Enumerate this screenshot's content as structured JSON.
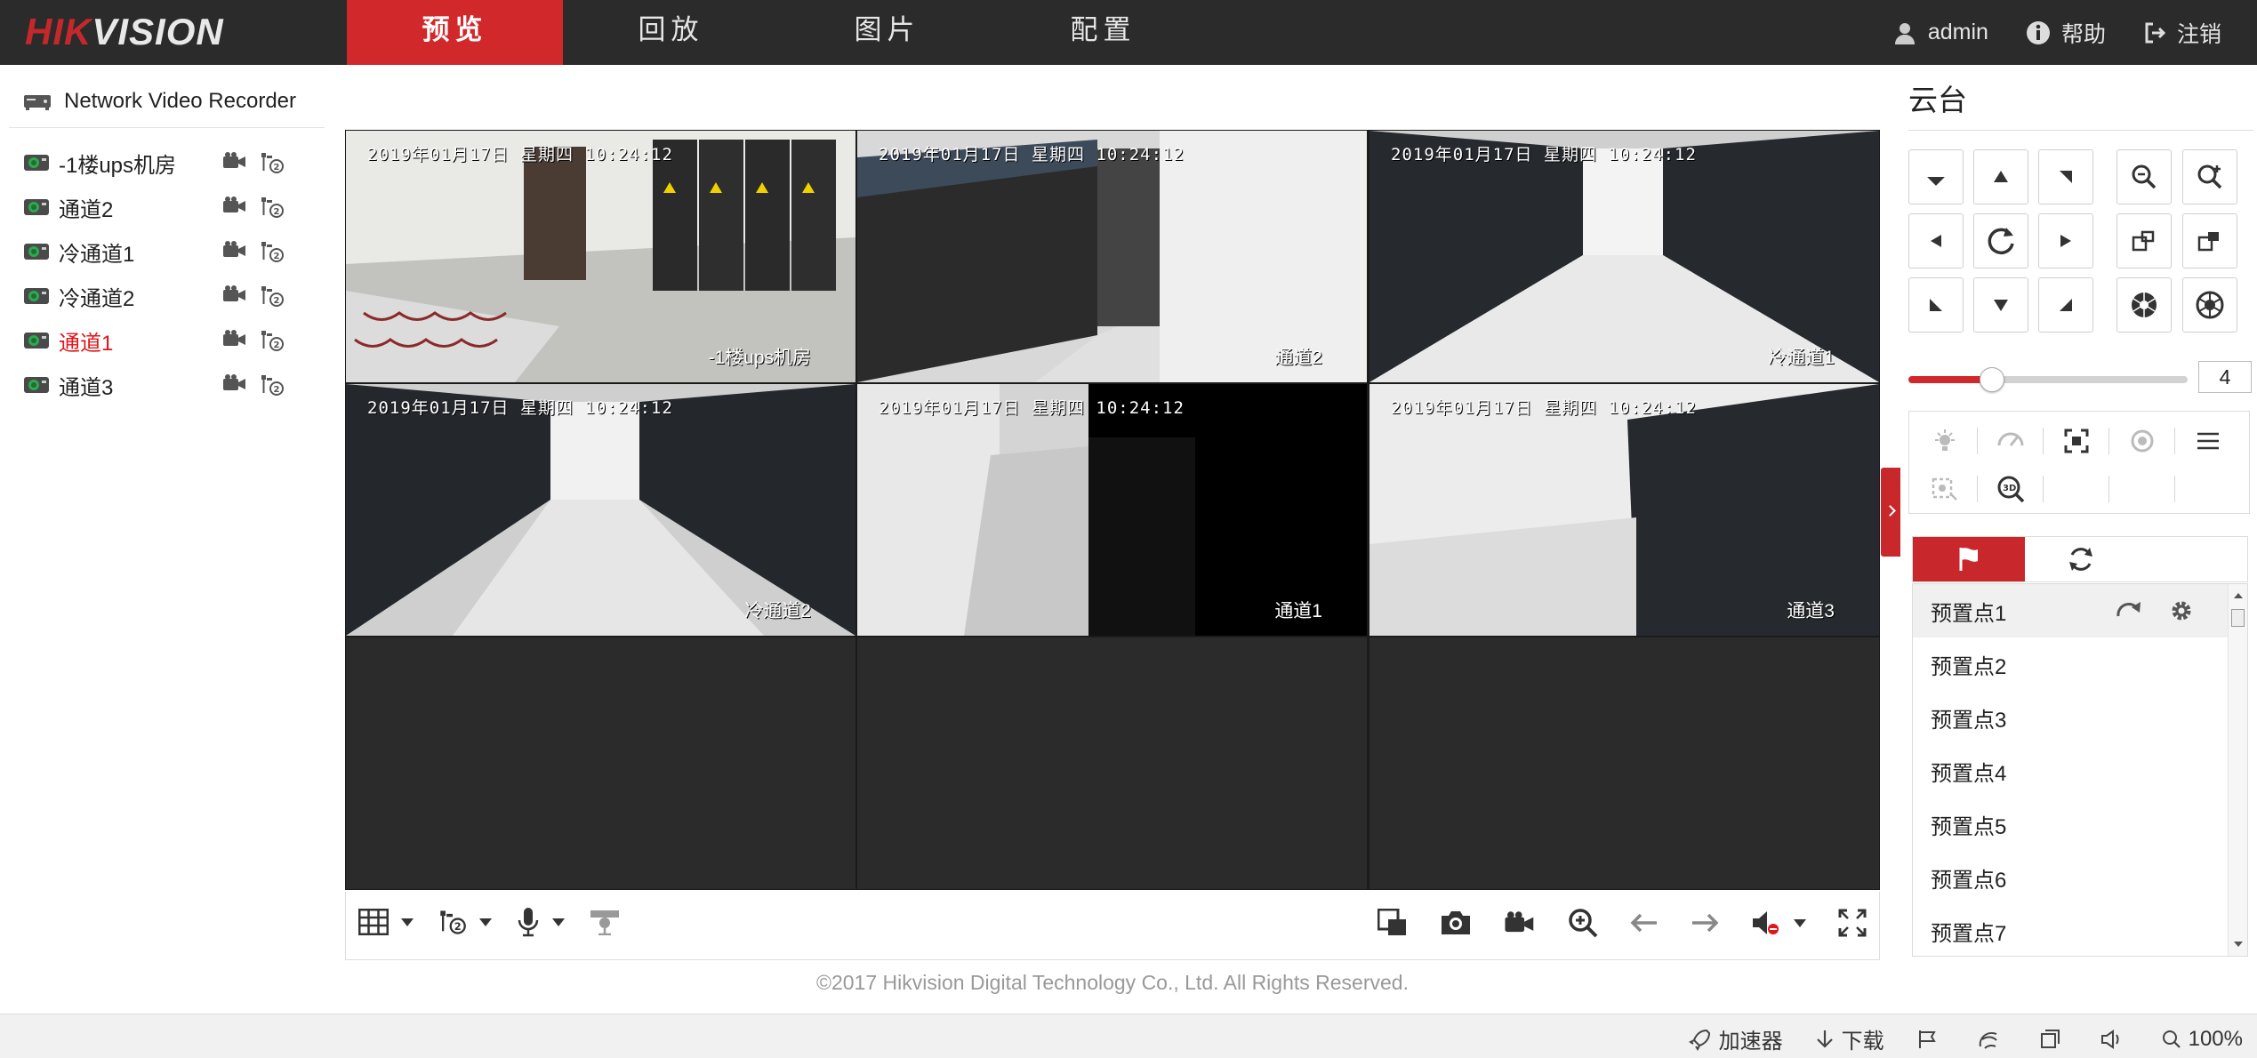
{
  "brand": {
    "logo_left": "HIK",
    "logo_right": "VISION",
    "accent": "#d0282b"
  },
  "nav": [
    {
      "label": "预览",
      "active": true
    },
    {
      "label": "回放",
      "active": false
    },
    {
      "label": "图片",
      "active": false
    },
    {
      "label": "配置",
      "active": false
    }
  ],
  "user_area": {
    "user": "admin",
    "help": "帮助",
    "logout": "注销"
  },
  "tree": {
    "device": "Network Video Recorder",
    "channels": [
      {
        "label": "-1楼ups机房",
        "active": false
      },
      {
        "label": "通道2",
        "active": false
      },
      {
        "label": "冷通道1",
        "active": false
      },
      {
        "label": "冷通道2",
        "active": false
      },
      {
        "label": "通道1",
        "active": true
      },
      {
        "label": "通道3",
        "active": false
      }
    ]
  },
  "video_grid": {
    "layout": "3x3",
    "cells": [
      {
        "osd": "2019年01月17日 星期四 10:24:12",
        "name": "-1楼ups机房"
      },
      {
        "osd": "2019年01月17日 星期四 10:24:12",
        "name": "通道2"
      },
      {
        "osd": "2019年01月17日 星期四 10:24:12",
        "name": "冷通道1"
      },
      {
        "osd": "2019年01月17日 星期四 10:24:12",
        "name": "冷通道2"
      },
      {
        "osd": "2019年01月17日 星期四 10:24:12",
        "name": "通道1"
      },
      {
        "osd": "2019年01月17日 星期四 10:24:12",
        "name": "通道3"
      }
    ]
  },
  "video_toolbar": {
    "left": [
      "layout-grid-icon",
      "stream-icon",
      "microphone-icon",
      "ptz-icon"
    ],
    "right": [
      "capture-all-icon",
      "camera-icon",
      "record-icon",
      "zoom-in-icon",
      "prev-page-icon",
      "next-page-icon",
      "volume-muted-icon",
      "fullscreen-icon"
    ]
  },
  "copyright": "©2017 Hikvision Digital Technology Co., Ltd. All Rights Reserved.",
  "statusbar": {
    "accelerator": "加速器",
    "download": "下载",
    "zoom": "100%"
  },
  "ptz": {
    "title": "云台",
    "speed": "4",
    "speed_fraction": 0.3,
    "presets": [
      "预置点1",
      "预置点2",
      "预置点3",
      "预置点4",
      "预置点5",
      "预置点6",
      "预置点7"
    ]
  }
}
